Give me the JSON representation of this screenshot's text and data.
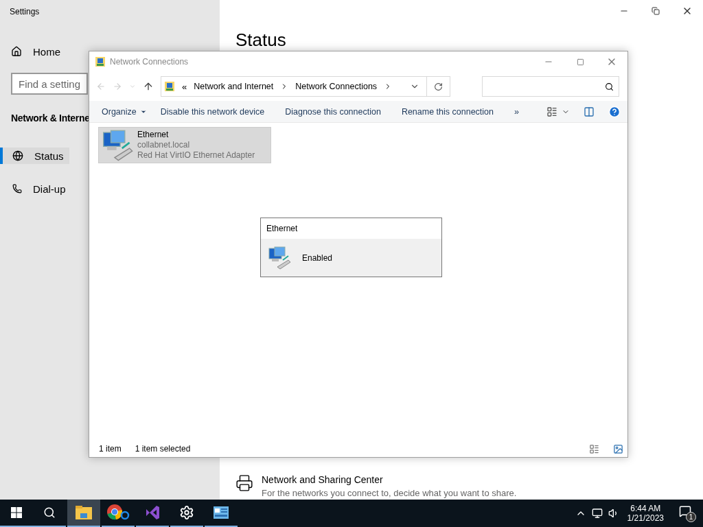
{
  "settings_window": {
    "title": "Settings",
    "home": "Home",
    "search": {
      "placeholder": "Find a setting"
    },
    "section": "Network & Interne",
    "nav": [
      {
        "label": "Status",
        "kind": "status",
        "selected": true
      },
      {
        "label": "Dial-up",
        "kind": "dialup",
        "selected": false
      }
    ],
    "page_title": "Status",
    "related": {
      "title": "Network and Sharing Center",
      "description": "For the networks you connect to, decide what you want to share."
    }
  },
  "explorer_window": {
    "title": "Network Connections",
    "address": {
      "overflow": "«",
      "crumbs": [
        "Network and Internet",
        "Network Connections"
      ]
    },
    "commands": [
      {
        "label": "Organize",
        "kind": "menu"
      },
      {
        "label": "Disable this network device",
        "kind": "plain"
      },
      {
        "label": "Diagnose this connection",
        "kind": "plain"
      },
      {
        "label": "Rename this connection",
        "kind": "plain"
      },
      {
        "label": "»",
        "kind": "more"
      }
    ],
    "items": [
      {
        "name": "Ethernet",
        "domain": "collabnet.local",
        "adapter": "Red Hat VirtIO Ethernet Adapter",
        "selected": true
      }
    ],
    "tooltip": {
      "title": "Ethernet",
      "status": "Enabled"
    },
    "status_bar": [
      "1 item",
      "1 item selected"
    ]
  },
  "taskbar": {
    "apps": [
      {
        "kind": "explorer",
        "active": true
      },
      {
        "kind": "chrome",
        "active": false
      },
      {
        "kind": "studio",
        "active": false
      },
      {
        "kind": "settings",
        "active": false
      },
      {
        "kind": "control",
        "active": false
      }
    ],
    "time": "6:44 AM",
    "date": "1/21/2023",
    "notifications": "1"
  }
}
